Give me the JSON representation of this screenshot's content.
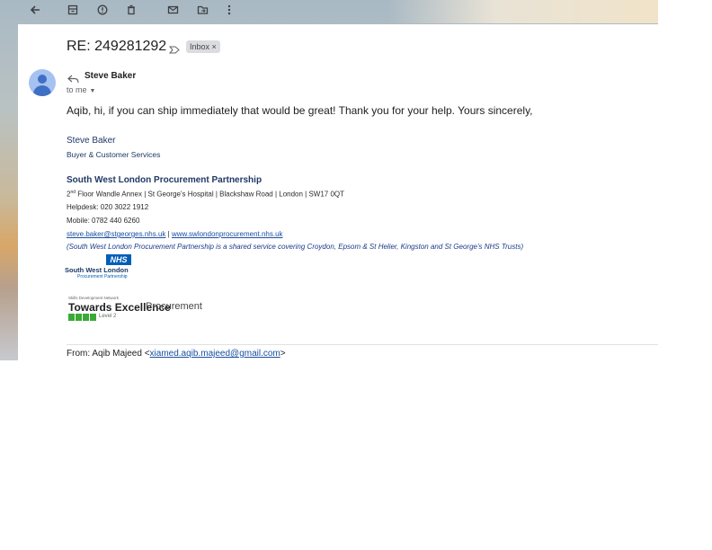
{
  "toolbar": {
    "icons": [
      "back-arrow-icon",
      "archive-icon",
      "report-spam-icon",
      "delete-icon",
      "mark-unread-icon",
      "move-to-icon",
      "more-vert-icon"
    ]
  },
  "email": {
    "subject": "RE: 249281292",
    "label": "Inbox ×",
    "sender": "Steve Baker",
    "to": "to me",
    "body": "Aqib, hi, if you can ship immediately that would be great! Thank you for your help. Yours sincerely,"
  },
  "signature": {
    "name": "Steve Baker",
    "role": "Buyer & Customer Services",
    "org": "South West London Procurement Partnership",
    "address_sup": "nd",
    "address_a": "2",
    "address_b": " Floor Wandle Annex | St George's Hospital | Blackshaw Road | London | SW17 0QT",
    "helpdesk": "Helpdesk: 020 3022 1912",
    "mobile": "Mobile: 0782 440 6260",
    "email": "steve.baker@stgeorges.nhs.uk",
    "link_sep": " | ",
    "website": "www.swlondonprocurement.nhs.uk",
    "note": "(South West London Procurement Partnership is a shared service covering Croydon, Epsom & St Helier, Kingston and St George's NHS Trusts)"
  },
  "logos": {
    "nhs_badge": "NHS",
    "nhs_title": "South West London",
    "nhs_sub": "Procurement Partnership",
    "te_small": "Skills Development Network",
    "te_title": "Towards Excellence",
    "te_proc": "Procurement",
    "te_level": "Level 2"
  },
  "quoted": {
    "from_label": "From: Aqib Majeed <",
    "from_email": "xiamed.aqib.majeed@gmail.com",
    "from_close": ">"
  },
  "colors": {
    "link": "#1a4fa0",
    "signature": "#1f3864",
    "nhs_blue": "#005eb8",
    "level_green": "#3aa935"
  }
}
